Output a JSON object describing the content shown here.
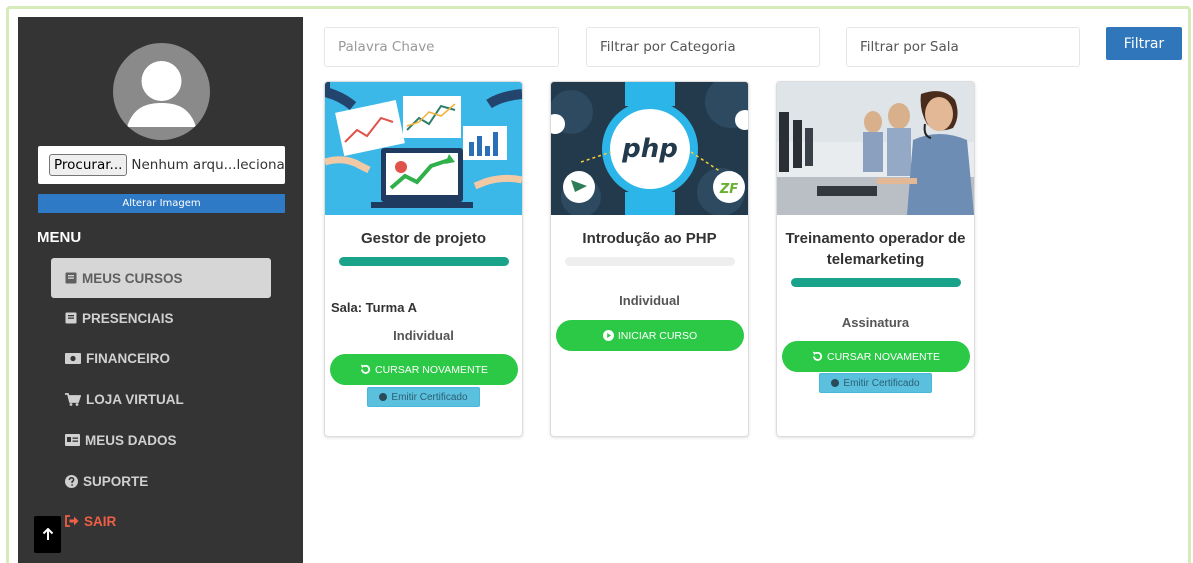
{
  "sidebar": {
    "file_button": "Procurar...",
    "file_name": "Nenhum arqu...lecionado.",
    "alter_image": "Alterar Imagem",
    "menu_title": "MENU",
    "items": [
      {
        "label": "MEUS CURSOS",
        "icon": "book-icon"
      },
      {
        "label": "PRESENCIAIS",
        "icon": "book-icon"
      },
      {
        "label": "FINANCEIRO",
        "icon": "money-icon"
      },
      {
        "label": "LOJA VIRTUAL",
        "icon": "cart-icon"
      },
      {
        "label": "MEUS DADOS",
        "icon": "id-card-icon"
      },
      {
        "label": "SUPORTE",
        "icon": "question-icon"
      },
      {
        "label": "SAIR",
        "icon": "sign-out-icon"
      }
    ]
  },
  "filters": {
    "keyword_placeholder": "Palavra Chave",
    "category_placeholder": "Filtrar por Categoria",
    "room_placeholder": "Filtrar por Sala",
    "filter_button": "Filtrar"
  },
  "courses": [
    {
      "title": "Gestor de projeto",
      "progress": 1.0,
      "room": "Sala: Turma A",
      "type": "Individual",
      "action": "CURSAR NOVAMENTE",
      "certificate": "Emitir Certificado"
    },
    {
      "title": "Introdução ao PHP",
      "progress": 0.0,
      "type": "Individual",
      "action": "INICIAR CURSO",
      "logo_text": "php"
    },
    {
      "title": "Treinamento operador de telemarketing",
      "progress": 1.0,
      "type": "Assinatura",
      "action": "CURSAR NOVAMENTE",
      "certificate": "Emitir Certificado"
    }
  ],
  "colors": {
    "sidebar": "#343434",
    "primary": "#2f76bb",
    "progress": "#1aa38b",
    "progress_empty": "#eeeeee",
    "action": "#2bc945",
    "certificate": "#5bc0de",
    "exit": "#ee5f45"
  }
}
